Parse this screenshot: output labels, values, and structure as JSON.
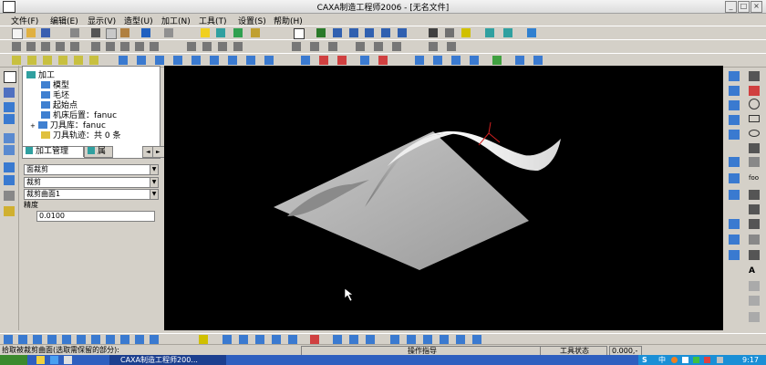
{
  "window": {
    "title": "CAXA制造工程师2006 - [无名文件]"
  },
  "menu": {
    "items": [
      "文件(F)",
      "编辑(E)",
      "显示(V)",
      "造型(U)",
      "加工(N)",
      "工具(T)",
      "设置(S)",
      "帮助(H)"
    ]
  },
  "tree": {
    "root": "加工",
    "children": [
      "模型",
      "毛坯",
      "起始点",
      "机床后置：fanuc",
      "刀具库：fanuc",
      "刀具轨迹：共 0 条"
    ]
  },
  "tabs": {
    "process": "加工管理",
    "property": "属"
  },
  "props": {
    "combo1": "面裁剪",
    "combo2": "裁剪",
    "combo3": "裁剪曲面1",
    "precision_label": "精度",
    "precision_value": "0.0100"
  },
  "status": {
    "prompt": "拾取被裁剪曲面(选取需保留的部分):",
    "command_hint": "操作指导",
    "tool_state": "工具状态",
    "coord": "0.000,-"
  },
  "taskbar": {
    "task_label": "CAXA制造工程师200...",
    "clock": "9:17",
    "ime": "中"
  }
}
